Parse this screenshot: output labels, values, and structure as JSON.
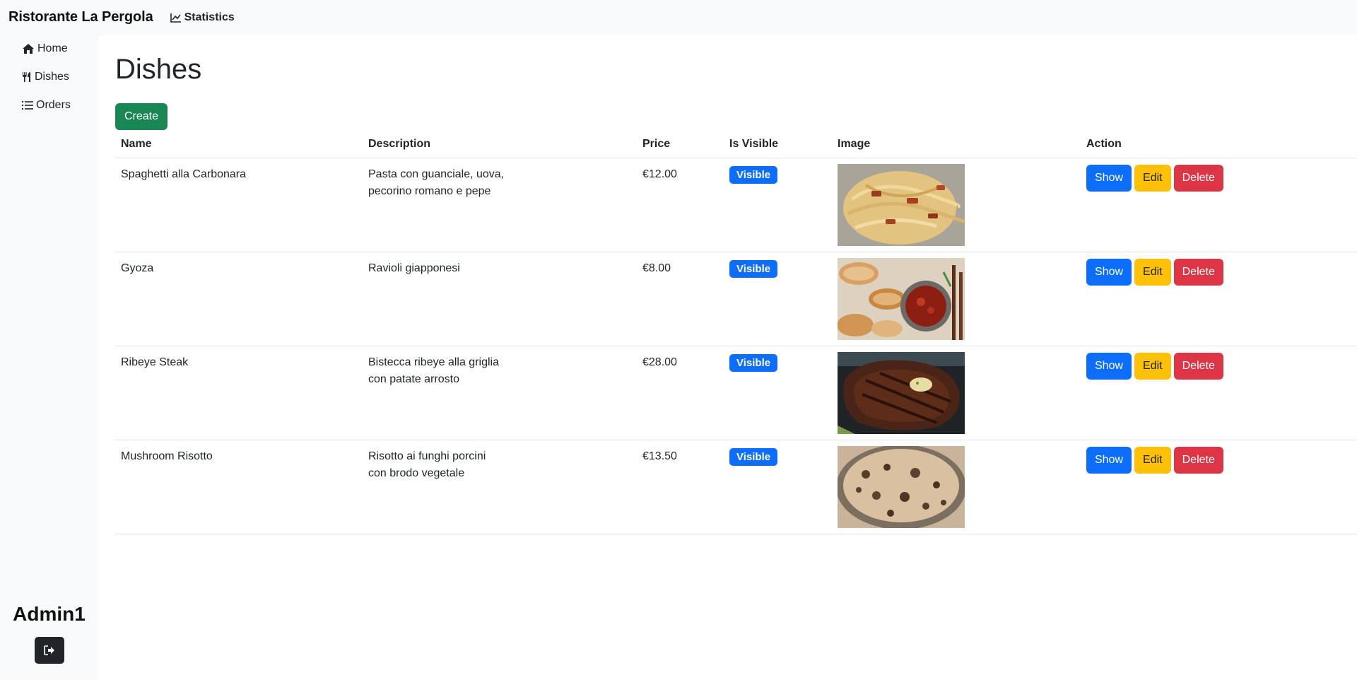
{
  "brand": "Ristorante La Pergola",
  "topnav": {
    "statistics": "Statistics"
  },
  "sidebar": {
    "items": [
      {
        "label": "Home",
        "icon": "house-icon"
      },
      {
        "label": "Dishes",
        "icon": "utensils-icon"
      },
      {
        "label": "Orders",
        "icon": "list-icon"
      }
    ],
    "admin": "Admin1",
    "logout_icon": "logout-icon"
  },
  "page": {
    "title": "Dishes",
    "create_label": "Create"
  },
  "table": {
    "columns": [
      "Name",
      "Description",
      "Price",
      "Is Visible",
      "Image",
      "Action"
    ],
    "rows": [
      {
        "name": "Spaghetti alla Carbonara",
        "desc1": "Pasta con guanciale, uova,",
        "desc2": "pecorino romano e pepe",
        "price": "€12.00",
        "visible": "Visible",
        "image": "carbonara-photo"
      },
      {
        "name": "Gyoza",
        "desc1": "Ravioli giapponesi",
        "desc2": "",
        "price": "€8.00",
        "visible": "Visible",
        "image": "gyoza-photo"
      },
      {
        "name": "Ribeye Steak",
        "desc1": "Bistecca ribeye alla griglia",
        "desc2": "con patate arrosto",
        "price": "€28.00",
        "visible": "Visible",
        "image": "steak-photo"
      },
      {
        "name": "Mushroom Risotto",
        "desc1": "Risotto ai funghi porcini",
        "desc2": "con brodo vegetale",
        "price": "€13.50",
        "visible": "Visible",
        "image": "risotto-photo"
      }
    ],
    "actions": {
      "show": "Show",
      "edit": "Edit",
      "delete": "Delete"
    }
  },
  "colors": {
    "primary": "#0d6efd",
    "success": "#198754",
    "warning": "#ffc107",
    "danger": "#dc3545",
    "dark": "#212529"
  }
}
